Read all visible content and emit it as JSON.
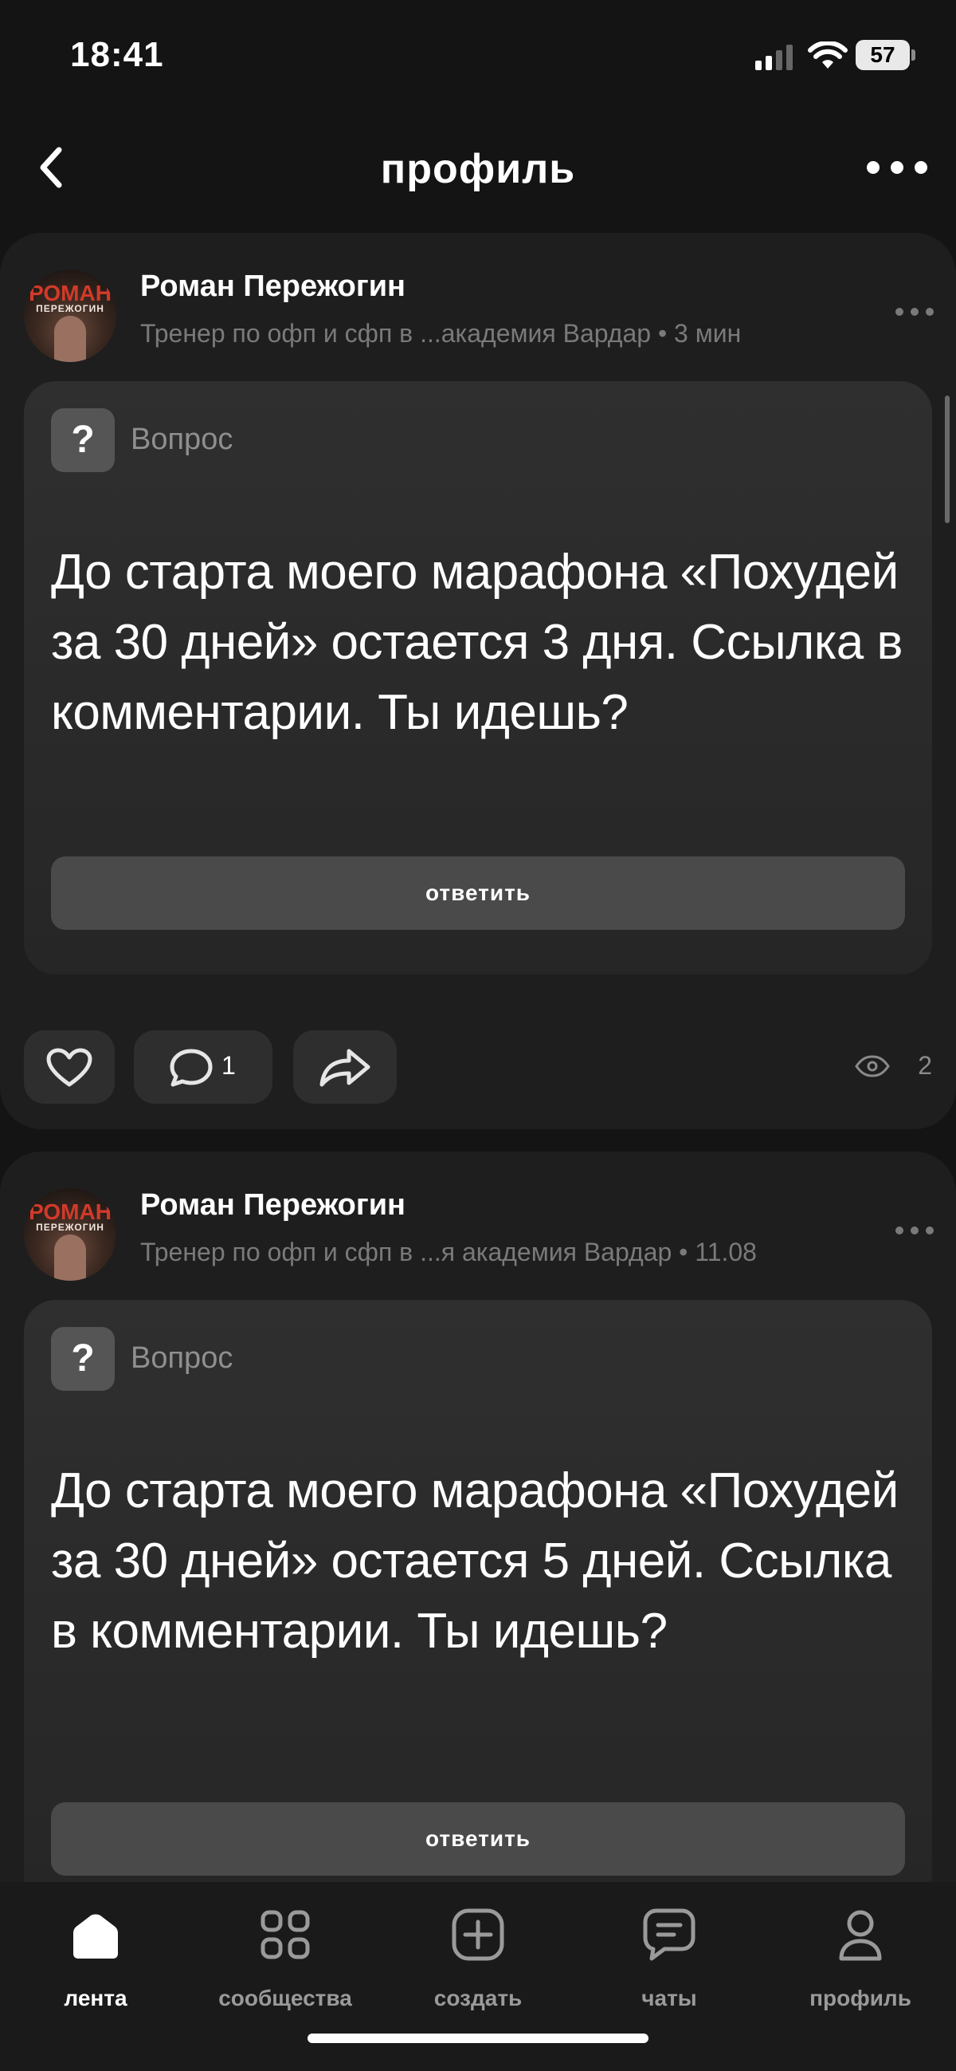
{
  "status": {
    "time": "18:41",
    "battery": "57"
  },
  "nav": {
    "title": "профиль"
  },
  "posts": [
    {
      "author": "Роман Пережогин",
      "meta": "Тренер по офп и сфп в ...академия Вардар • 3 мин",
      "avatar_text": "РОМАН",
      "avatar_sub": "ПЕРЕЖОГИН",
      "question_label": "Вопрос",
      "question_icon": "?",
      "question_text": "До старта моего марафона «Похудей за 30 дней» остается 3 дня. Ссылка в комментарии. Ты идешь?",
      "reply_label": "ответить",
      "comments": "1",
      "views": "2"
    },
    {
      "author": "Роман Пережогин",
      "meta": "Тренер по офп и сфп в ...я академия Вардар • 11.08",
      "avatar_text": "РОМАН",
      "avatar_sub": "ПЕРЕЖОГИН",
      "question_label": "Вопрос",
      "question_icon": "?",
      "question_text": "До старта моего марафона «Похудей за 30 дней» остается 5 дней. Ссылка в комментарии. Ты идешь?",
      "reply_label": "ответить"
    }
  ],
  "tabs": [
    {
      "label": "лента",
      "icon": "home-icon",
      "active": true
    },
    {
      "label": "сообщества",
      "icon": "grid-icon"
    },
    {
      "label": "создать",
      "icon": "plus-square-icon"
    },
    {
      "label": "чаты",
      "icon": "chat-icon"
    },
    {
      "label": "профиль",
      "icon": "person-icon"
    }
  ]
}
